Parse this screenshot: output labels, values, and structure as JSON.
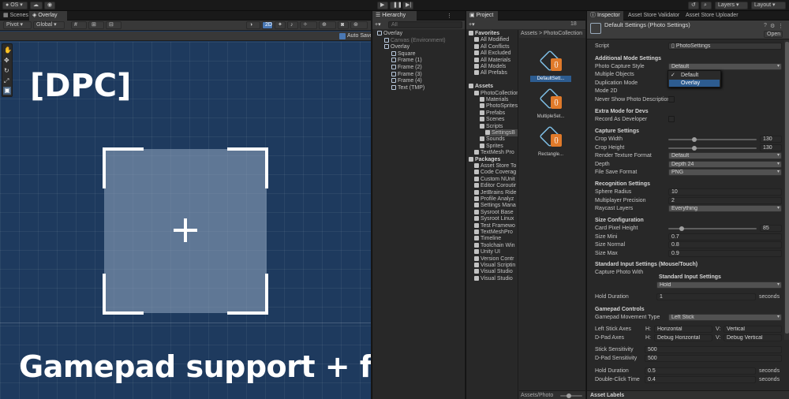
{
  "toolbar": {
    "account": "OS",
    "layers": "Layers",
    "layout": "Layout"
  },
  "scene": {
    "tabs": [
      "Scenes",
      "Overlay"
    ],
    "pivot": "Pivot",
    "global": "Global",
    "mode_2d": "2D",
    "auto_save": "Auto Save",
    "tag": "[DPC]",
    "caption": "Gamepad support + frame overlay"
  },
  "hierarchy": {
    "tab": "Hierarchy",
    "search_placeholder": "All",
    "items": [
      {
        "label": "Overlay",
        "depth": 0
      },
      {
        "label": "Canvas (Environment)",
        "depth": 1
      },
      {
        "label": "Overlay",
        "depth": 1
      },
      {
        "label": "Square",
        "depth": 2
      },
      {
        "label": "Frame (1)",
        "depth": 2
      },
      {
        "label": "Frame (2)",
        "depth": 2
      },
      {
        "label": "Frame (3)",
        "depth": 2
      },
      {
        "label": "Frame (4)",
        "depth": 2
      },
      {
        "label": "Text (TMP)",
        "depth": 2
      }
    ]
  },
  "project": {
    "tab": "Project",
    "count": "18",
    "breadcrumb": "Assets > PhotoCollection",
    "footer_path": "Assets/Photo",
    "tree": [
      {
        "label": "Favorites",
        "depth": 0,
        "bold": true
      },
      {
        "label": "All Modified",
        "depth": 1
      },
      {
        "label": "All Conflicts",
        "depth": 1
      },
      {
        "label": "All Excluded",
        "depth": 1
      },
      {
        "label": "All Materials",
        "depth": 1
      },
      {
        "label": "All Models",
        "depth": 1
      },
      {
        "label": "All Prefabs",
        "depth": 1
      },
      {
        "label": "",
        "depth": 1
      },
      {
        "label": "Assets",
        "depth": 0,
        "bold": true
      },
      {
        "label": "PhotoCollection",
        "depth": 1
      },
      {
        "label": "Materials",
        "depth": 2
      },
      {
        "label": "PhotoSprites",
        "depth": 2
      },
      {
        "label": "Prefabs",
        "depth": 2
      },
      {
        "label": "Scenes",
        "depth": 2
      },
      {
        "label": "Scripts",
        "depth": 2
      },
      {
        "label": "SettingsB",
        "depth": 3
      },
      {
        "label": "Sounds",
        "depth": 2
      },
      {
        "label": "Sprites",
        "depth": 2
      },
      {
        "label": "TextMesh Pro",
        "depth": 1
      },
      {
        "label": "Packages",
        "depth": 0,
        "bold": true
      },
      {
        "label": "Asset Store To",
        "depth": 1
      },
      {
        "label": "Code Coverag",
        "depth": 1
      },
      {
        "label": "Custom NUnit",
        "depth": 1
      },
      {
        "label": "Editor Coroutir",
        "depth": 1
      },
      {
        "label": "JetBrains Ride",
        "depth": 1
      },
      {
        "label": "Profile Analyz",
        "depth": 1
      },
      {
        "label": "Settings Mana",
        "depth": 1
      },
      {
        "label": "Sysroot Base",
        "depth": 1
      },
      {
        "label": "Sysroot Linux",
        "depth": 1
      },
      {
        "label": "Test Framewo",
        "depth": 1
      },
      {
        "label": "TextMeshPro",
        "depth": 1
      },
      {
        "label": "Timeline",
        "depth": 1
      },
      {
        "label": "Toolchain Win",
        "depth": 1
      },
      {
        "label": "Unity UI",
        "depth": 1
      },
      {
        "label": "Version Contr",
        "depth": 1
      },
      {
        "label": "Visual Scriptin",
        "depth": 1
      },
      {
        "label": "Visual Studio",
        "depth": 1
      },
      {
        "label": "Visual Studio",
        "depth": 1
      }
    ],
    "assets": [
      "DefaultSett...",
      "MultipleSet...",
      "Rectangle..."
    ]
  },
  "inspector": {
    "tabs": [
      "Inspector",
      "Asset Store Validator",
      "Asset Store Uploader"
    ],
    "title": "Default Settings (Photo Settings)",
    "open": "Open",
    "script_label": "Script",
    "script_value": "PhotoSettings",
    "sections": {
      "additional": "Additional Mode Settings",
      "extra": "Extra Mode for Devs",
      "capture": "Capture Settings",
      "recognition": "Recognition Settings",
      "size": "Size Configuration",
      "standard_input": "Standard Input Settings (Mouse/Touch)",
      "gamepad": "Gamepad Controls"
    },
    "photo_capture_style": {
      "label": "Photo Capture Style",
      "value": "Default",
      "options": [
        "Default",
        "Overlay"
      ]
    },
    "multiple_objects": "Multiple Objects",
    "duplication_mode": "Duplication Mode",
    "mode_2d": "Mode 2D",
    "never_show": "Never Show Photo Description",
    "record_as_dev": "Record As Developer",
    "crop_width": {
      "label": "Crop Width",
      "value": "130"
    },
    "crop_height": {
      "label": "Crop Height",
      "value": "130"
    },
    "render_texture_format": {
      "label": "Render Texture Format",
      "value": "Default"
    },
    "depth": {
      "label": "Depth",
      "value": "Depth 24"
    },
    "file_save_format": {
      "label": "File Save Format",
      "value": "PNG"
    },
    "sphere_radius": {
      "label": "Sphere Radius",
      "value": "10"
    },
    "multiplayer_precision": {
      "label": "Multiplayer Precision",
      "value": "2"
    },
    "raycast_layers": {
      "label": "Raycast Layers",
      "value": "Everything"
    },
    "card_pixel_height": {
      "label": "Card Pixel Height",
      "value": "85"
    },
    "size_mini": {
      "label": "Size Mini",
      "value": "0.7"
    },
    "size_normal": {
      "label": "Size Normal",
      "value": "0.8"
    },
    "size_max": {
      "label": "Size Max",
      "value": "0.9"
    },
    "capture_photo_with": "Capture Photo With",
    "standard_input_sub": "Standard Input Settings",
    "hold": "Hold",
    "hold_duration": {
      "label": "Hold Duration",
      "value": "1",
      "unit": "seconds"
    },
    "gamepad_movement": {
      "label": "Gamepad Movement Type",
      "value": "Left Stick"
    },
    "left_stick_axes": {
      "label": "Left Stick Axes",
      "h": "Horizontal",
      "v": "Vertical"
    },
    "dpad_axes": {
      "label": "D-Pad Axes",
      "h": "Debug Horizontal",
      "v": "Debug Vertical"
    },
    "h_prefix": "H:",
    "v_prefix": "V:",
    "stick_sensitivity": {
      "label": "Stick Sensitivity",
      "value": "500"
    },
    "dpad_sensitivity": {
      "label": "D-Pad Sensitivity",
      "value": "500"
    },
    "gp_hold_duration": {
      "label": "Hold Duration",
      "value": "0.5",
      "unit": "seconds"
    },
    "double_click": {
      "label": "Double-Click Time",
      "value": "0.4",
      "unit": "seconds"
    },
    "asset_labels": "Asset Labels"
  }
}
